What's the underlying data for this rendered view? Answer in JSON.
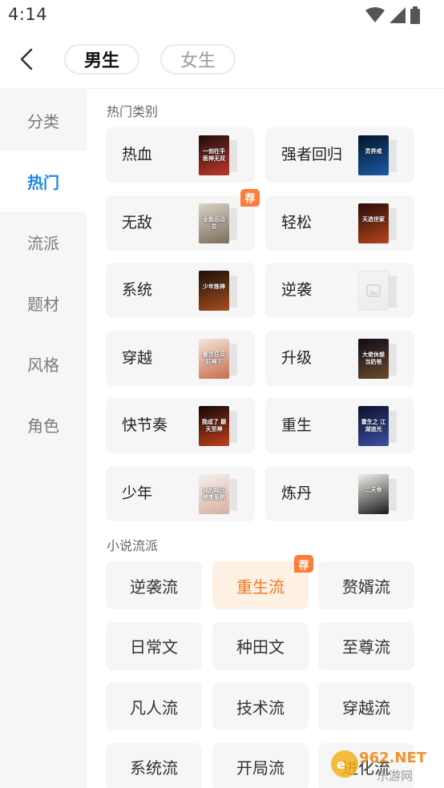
{
  "status": {
    "time": "4:14"
  },
  "header": {
    "tabs": [
      {
        "label": "男生",
        "active": true
      },
      {
        "label": "女生",
        "active": false
      }
    ]
  },
  "sidebar": {
    "items": [
      {
        "label": "分类",
        "active": false
      },
      {
        "label": "热门",
        "active": true
      },
      {
        "label": "流派",
        "active": false
      },
      {
        "label": "题材",
        "active": false
      },
      {
        "label": "风格",
        "active": false
      },
      {
        "label": "角色",
        "active": false
      }
    ]
  },
  "hot": {
    "title": "热门类别",
    "items": [
      {
        "label": "热血",
        "cover_text": "一剑在手 医神无双",
        "cover_colors": [
          "#1a0d0d",
          "#c0392b"
        ],
        "badge": ""
      },
      {
        "label": "强者回归",
        "cover_text": "灵界戒",
        "cover_colors": [
          "#04142a",
          "#1c5aa6"
        ],
        "badge": ""
      },
      {
        "label": "无敌",
        "cover_text": "全能运动员",
        "cover_colors": [
          "#d9d2c6",
          "#7d6c5a"
        ],
        "badge": "荐"
      },
      {
        "label": "轻松",
        "cover_text": "天选世家",
        "cover_colors": [
          "#2a0b0b",
          "#b5451b"
        ],
        "badge": ""
      },
      {
        "label": "系统",
        "cover_text": "少年炼神",
        "cover_colors": [
          "#1b0f08",
          "#a84f1e"
        ],
        "badge": ""
      },
      {
        "label": "逆袭",
        "cover_text": "",
        "cover_colors": [
          "#f4f4f4",
          "#ececec"
        ],
        "badge": ""
      },
      {
        "label": "穿越",
        "cover_text": "都市狂兵 狂神下",
        "cover_colors": [
          "#f2e6dc",
          "#c76d4d"
        ],
        "badge": ""
      },
      {
        "label": "升级",
        "cover_text": "大佬休想 当奶爸",
        "cover_colors": [
          "#0f0c1a",
          "#6a4a2a"
        ],
        "badge": ""
      },
      {
        "label": "快节奏",
        "cover_text": "我成了 巅天至神",
        "cover_colors": [
          "#120806",
          "#c2401a"
        ],
        "badge": ""
      },
      {
        "label": "重生",
        "cover_text": "重生之 江湖追光",
        "cover_colors": [
          "#0b1030",
          "#3d4fa0"
        ],
        "badge": ""
      },
      {
        "label": "少年",
        "cover_text": "我的超凡 修炼系统",
        "cover_colors": [
          "#f6f0ea",
          "#d4b0a0"
        ],
        "badge": ""
      },
      {
        "label": "炼丹",
        "cover_text": "二天帝",
        "cover_colors": [
          "#f4f1ec",
          "#1a1a1a"
        ],
        "badge": ""
      }
    ]
  },
  "genres": {
    "title": "小说流派",
    "items": [
      {
        "label": "逆袭流",
        "highlight": false,
        "badge": ""
      },
      {
        "label": "重生流",
        "highlight": true,
        "badge": "荐"
      },
      {
        "label": "赘婿流",
        "highlight": false,
        "badge": ""
      },
      {
        "label": "日常文",
        "highlight": false,
        "badge": ""
      },
      {
        "label": "种田文",
        "highlight": false,
        "badge": ""
      },
      {
        "label": "至尊流",
        "highlight": false,
        "badge": ""
      },
      {
        "label": "凡人流",
        "highlight": false,
        "badge": ""
      },
      {
        "label": "技术流",
        "highlight": false,
        "badge": ""
      },
      {
        "label": "穿越流",
        "highlight": false,
        "badge": ""
      },
      {
        "label": "系统流",
        "highlight": false,
        "badge": ""
      },
      {
        "label": "开局流",
        "highlight": false,
        "badge": ""
      },
      {
        "label": "进化流",
        "highlight": false,
        "badge": ""
      }
    ]
  },
  "watermark": {
    "text": "962.NET",
    "subtext": "乐游网"
  }
}
